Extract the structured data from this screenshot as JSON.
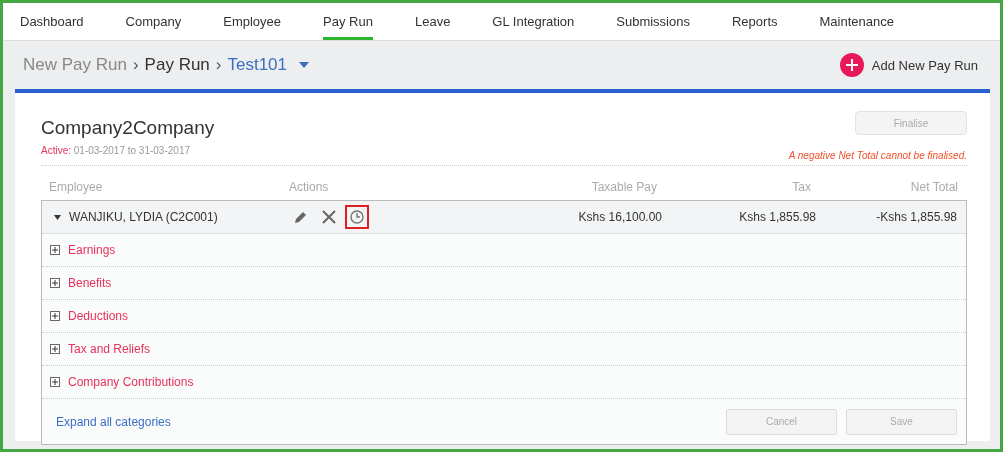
{
  "nav": [
    {
      "label": "Dashboard",
      "selected": false
    },
    {
      "label": "Company",
      "selected": false
    },
    {
      "label": "Employee",
      "selected": false
    },
    {
      "label": "Pay Run",
      "selected": true
    },
    {
      "label": "Leave",
      "selected": false
    },
    {
      "label": "GL Integration",
      "selected": false
    },
    {
      "label": "Submissions",
      "selected": false
    },
    {
      "label": "Reports",
      "selected": false
    },
    {
      "label": "Maintenance",
      "selected": false
    }
  ],
  "breadcrumb": {
    "items": [
      "New Pay Run",
      "Pay Run"
    ],
    "current": "Test101",
    "separator": "›"
  },
  "add_button": {
    "label": "Add New Pay Run"
  },
  "company": {
    "name": "Company2Company",
    "active_label": "Active:",
    "period": "01-03-2017 to 31-03-2017"
  },
  "finalise": {
    "label": "Finalise",
    "disabled": true,
    "warning": "A negative Net Total cannot be finalised."
  },
  "table": {
    "columns": [
      "Employee",
      "Actions",
      "Taxable Pay",
      "Tax",
      "Net Total"
    ],
    "employee": {
      "name": "WANJIKU, LYDIA (C2C001)",
      "expanded": true,
      "taxable_pay": "Kshs 16,100.00",
      "tax": "Kshs 1,855.98",
      "net_total": "-Kshs 1,855.98",
      "actions": [
        {
          "kind": "edit",
          "highlighted": false
        },
        {
          "kind": "delete",
          "highlighted": false
        },
        {
          "kind": "history",
          "highlighted": true
        }
      ]
    },
    "categories": [
      {
        "label": "Earnings",
        "expanded": false
      },
      {
        "label": "Benefits",
        "expanded": false
      },
      {
        "label": "Deductions",
        "expanded": false
      },
      {
        "label": "Tax and Reliefs",
        "expanded": false
      },
      {
        "label": "Company Contributions",
        "expanded": false
      }
    ]
  },
  "footer": {
    "link": "Expand all categories",
    "buttons": [
      {
        "label": "Cancel",
        "disabled": true
      },
      {
        "label": "Save",
        "disabled": true
      }
    ]
  }
}
